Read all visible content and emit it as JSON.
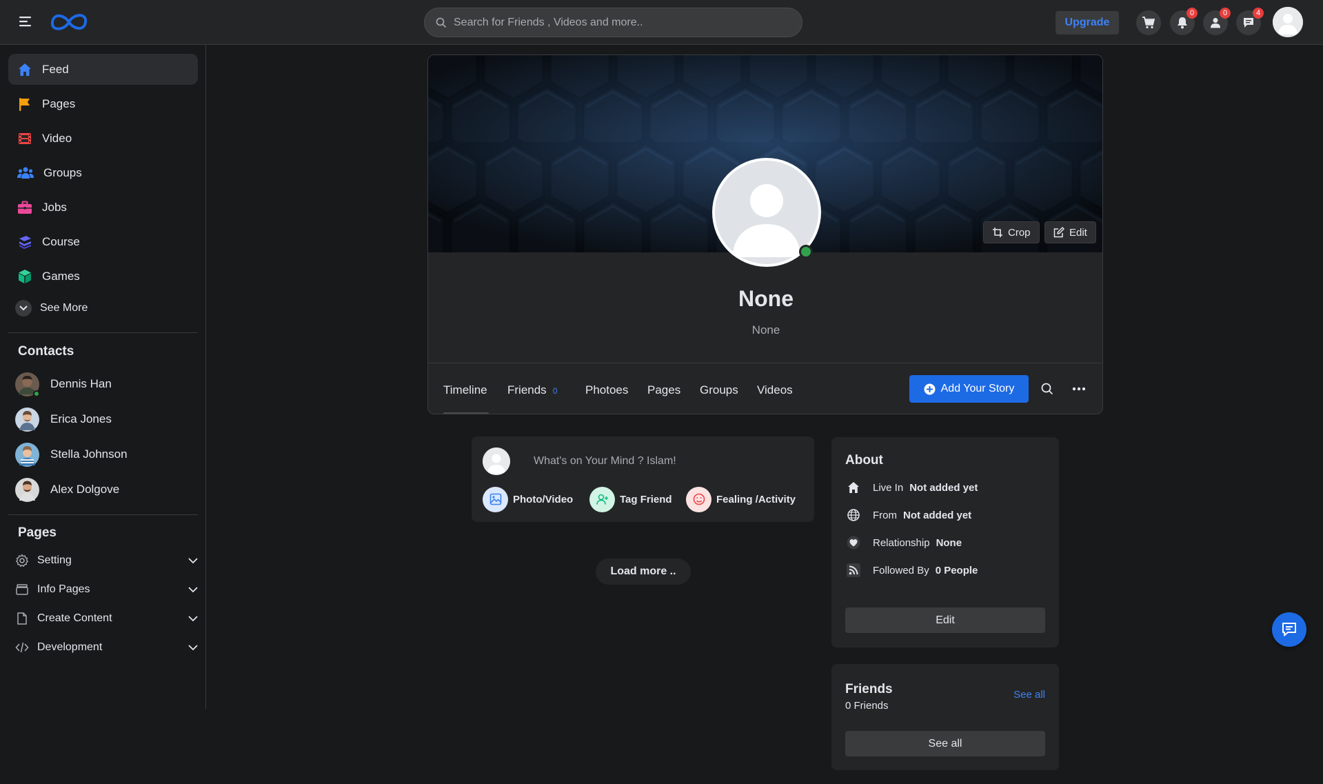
{
  "header": {
    "search_placeholder": "Search for Friends , Videos and more..",
    "upgrade_label": "Upgrade",
    "badges": {
      "notifications": "0",
      "friend_requests": "0",
      "messages": "4"
    }
  },
  "sidebar": {
    "nav": [
      {
        "label": "Feed",
        "icon": "home-icon",
        "color": "#3b82f6"
      },
      {
        "label": "Pages",
        "icon": "flag-icon",
        "color": "#f59e0b"
      },
      {
        "label": "Video",
        "icon": "film-icon",
        "color": "#ef4444"
      },
      {
        "label": "Groups",
        "icon": "users-icon",
        "color": "#3b82f6"
      },
      {
        "label": "Jobs",
        "icon": "briefcase-icon",
        "color": "#ec4899"
      },
      {
        "label": "Course",
        "icon": "graduation-cap-icon",
        "color": "#6366f1"
      },
      {
        "label": "Games",
        "icon": "cube-icon",
        "color": "#10b981"
      }
    ],
    "see_more_label": "See More",
    "contacts_title": "Contacts",
    "contacts": [
      {
        "name": "Dennis Han",
        "online": true
      },
      {
        "name": "Erica Jones",
        "online": false
      },
      {
        "name": "Stella Johnson",
        "online": false
      },
      {
        "name": "Alex Dolgove",
        "online": false
      }
    ],
    "pages_title": "Pages",
    "pages": [
      {
        "label": "Setting",
        "icon": "gear-icon"
      },
      {
        "label": "Info Pages",
        "icon": "archive-icon"
      },
      {
        "label": "Create Content",
        "icon": "file-icon"
      },
      {
        "label": "Development",
        "icon": "code-icon"
      }
    ]
  },
  "profile": {
    "name": "None",
    "subtitle": "None",
    "crop_label": "Crop",
    "edit_label": "Edit",
    "tabs": [
      {
        "label": "Timeline"
      },
      {
        "label": "Friends",
        "count": "0"
      },
      {
        "label": "Photoes"
      },
      {
        "label": "Pages"
      },
      {
        "label": "Groups"
      },
      {
        "label": "Videos"
      }
    ],
    "add_story_label": "Add Your Story"
  },
  "composer": {
    "placeholder": "What's on Your Mind ? Islam!",
    "actions": [
      {
        "label": "Photo/Video",
        "icon": "image-icon",
        "color": "#3b82f6"
      },
      {
        "label": "Tag Friend",
        "icon": "user-plus-icon",
        "color": "#10b981"
      },
      {
        "label": "Fealing /Activity",
        "icon": "smile-icon",
        "color": "#ef4444"
      }
    ]
  },
  "feed": {
    "load_more_label": "Load more .."
  },
  "about": {
    "title": "About",
    "rows": [
      {
        "key": "Live In",
        "value": "Not added yet",
        "icon": "home-icon"
      },
      {
        "key": "From",
        "value": "Not added yet",
        "icon": "globe-icon"
      },
      {
        "key": "Relationship",
        "value": "None",
        "icon": "heart-icon"
      },
      {
        "key": "Followed By",
        "value": "0 People",
        "icon": "rss-icon"
      }
    ],
    "edit_label": "Edit"
  },
  "friends_box": {
    "title": "Friends",
    "count_text": "0 Friends",
    "see_all_link": "See all",
    "see_all_button": "See all"
  }
}
